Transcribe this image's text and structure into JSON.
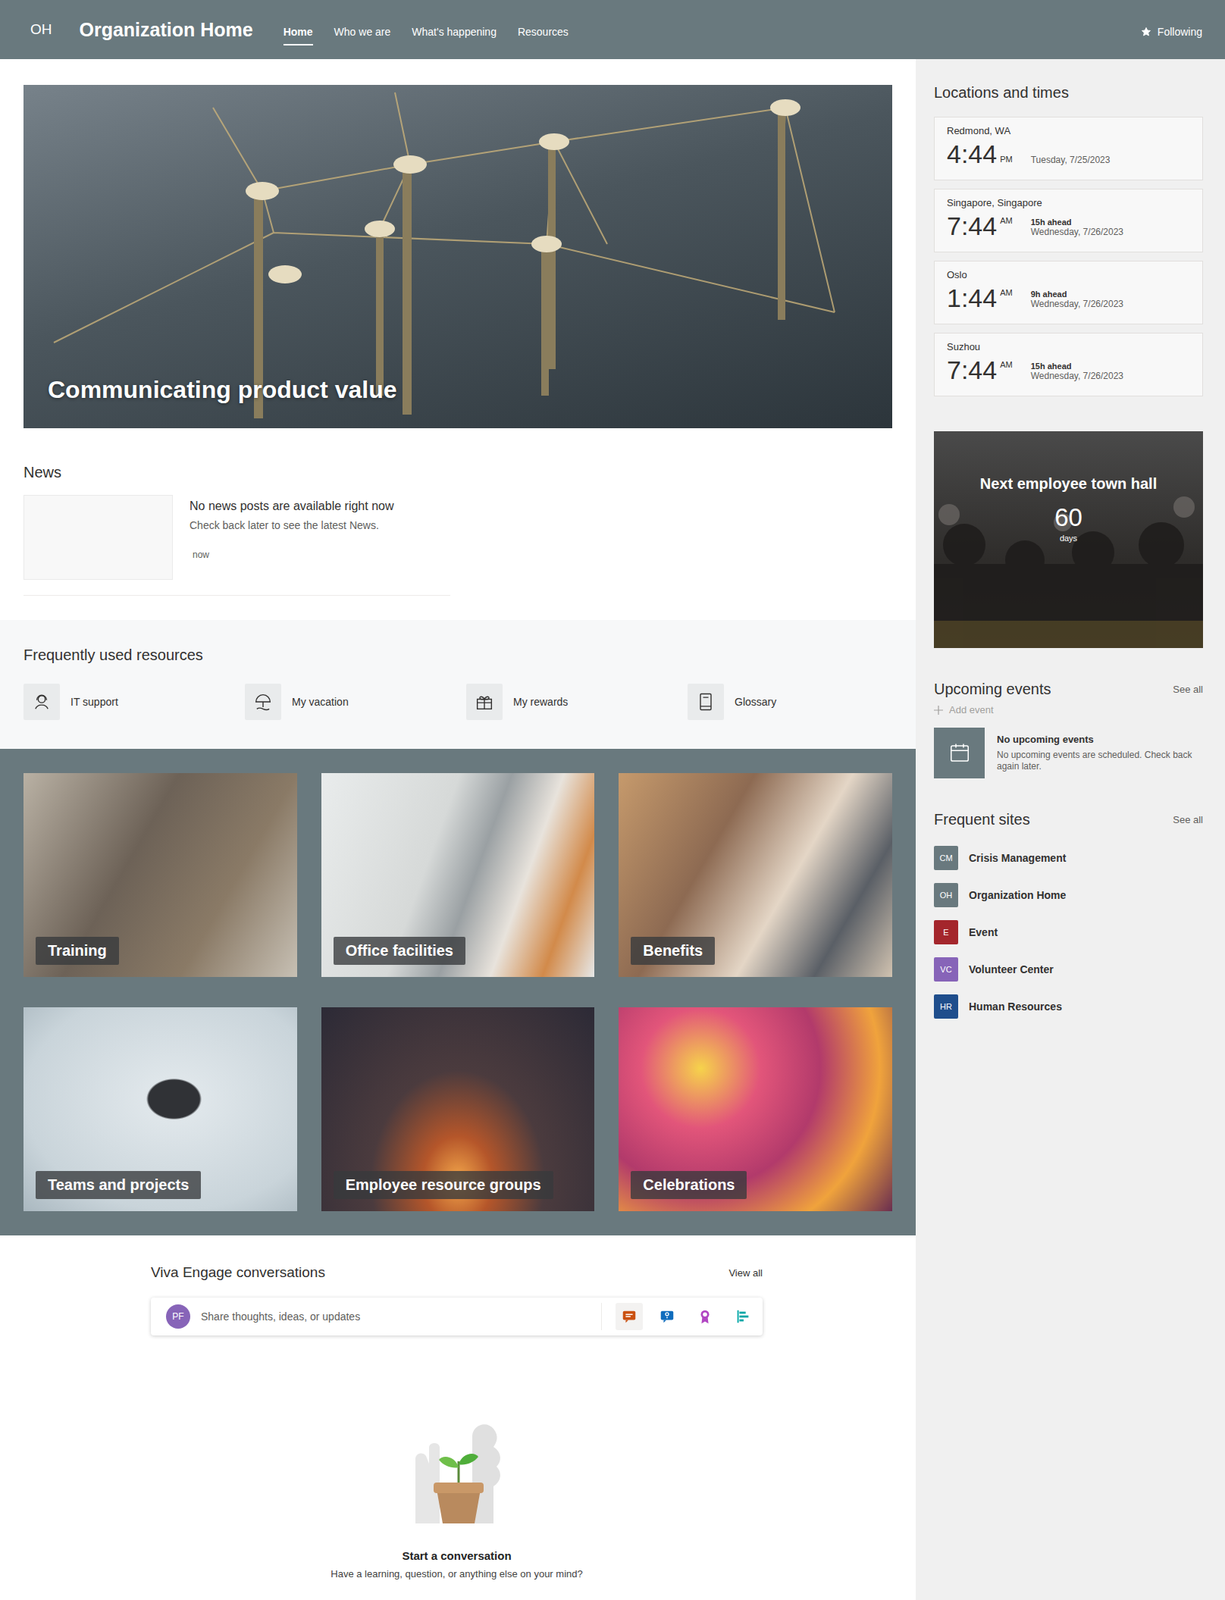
{
  "header": {
    "logo": "OH",
    "title": "Organization Home",
    "nav": [
      {
        "label": "Home",
        "selected": true
      },
      {
        "label": "Who we are",
        "selected": false
      },
      {
        "label": "What's happening",
        "selected": false
      },
      {
        "label": "Resources",
        "selected": false
      }
    ],
    "follow": {
      "label": "Following",
      "on": true
    }
  },
  "hero": {
    "title": "Communicating product value"
  },
  "news": {
    "title": "News",
    "item": {
      "title": "No news posts are available right now",
      "text": "Check back later to see the latest News.",
      "time": "now"
    }
  },
  "resources": {
    "title": "Frequently used resources",
    "items": [
      {
        "label": "IT support",
        "kind": "support"
      },
      {
        "label": "My vacation",
        "kind": "vacation"
      },
      {
        "label": "My rewards",
        "kind": "rewards"
      },
      {
        "label": "Glossary",
        "kind": "glossary"
      }
    ]
  },
  "tiles": [
    {
      "label": "Training"
    },
    {
      "label": "Office facilities"
    },
    {
      "label": "Benefits"
    },
    {
      "label": "Teams and projects"
    },
    {
      "label": "Employee resource groups"
    },
    {
      "label": "Celebrations"
    }
  ],
  "engage": {
    "title": "Viva Engage conversations",
    "view_all": "View all",
    "avatar": "PF",
    "placeholder": "Share thoughts, ideas, or updates",
    "post_types": [
      {
        "kind": "discussion",
        "selected": true,
        "color": "#ca5010"
      },
      {
        "kind": "question",
        "selected": false,
        "color": "#0f6cbd"
      },
      {
        "kind": "praise",
        "selected": false,
        "color": "#b146c2"
      },
      {
        "kind": "poll",
        "selected": false,
        "color": "#00a6a6"
      }
    ],
    "empty_title": "Start a conversation",
    "empty_text": "Have a learning, question, or anything else on your mind?"
  },
  "clocks": {
    "title": "Locations and times",
    "items": [
      {
        "city": "Redmond, WA",
        "time": "4:44",
        "ampm": "PM",
        "date": "Tuesday, 7/25/2023"
      },
      {
        "city": "Singapore, Singapore",
        "time": "7:44",
        "ampm": "AM",
        "offset": "15h ahead",
        "date": "Wednesday, 7/26/2023"
      },
      {
        "city": "Oslo",
        "time": "1:44",
        "ampm": "AM",
        "offset": "9h ahead",
        "date": "Wednesday, 7/26/2023"
      },
      {
        "city": "Suzhou",
        "time": "7:44",
        "ampm": "AM",
        "offset": "15h ahead",
        "date": "Wednesday, 7/26/2023"
      }
    ]
  },
  "countdown": {
    "title": "Next employee town hall",
    "number": "60",
    "unit": "days"
  },
  "events": {
    "title": "Upcoming events",
    "see_all": "See all",
    "add": "Add event",
    "empty_title": "No upcoming events",
    "empty_text": "No upcoming events are scheduled. Check back again later."
  },
  "sites": {
    "title": "Frequent sites",
    "see_all": "See all",
    "items": [
      {
        "initials": "CM",
        "name": "Crisis Management",
        "color": "#69797e"
      },
      {
        "initials": "OH",
        "name": "Organization Home",
        "color": "#69797e"
      },
      {
        "initials": "E",
        "name": "Event",
        "color": "#a4262c"
      },
      {
        "initials": "VC",
        "name": "Volunteer Center",
        "color": "#8764b8"
      },
      {
        "initials": "HR",
        "name": "Human Resources",
        "color": "#1f4e8c"
      }
    ]
  }
}
